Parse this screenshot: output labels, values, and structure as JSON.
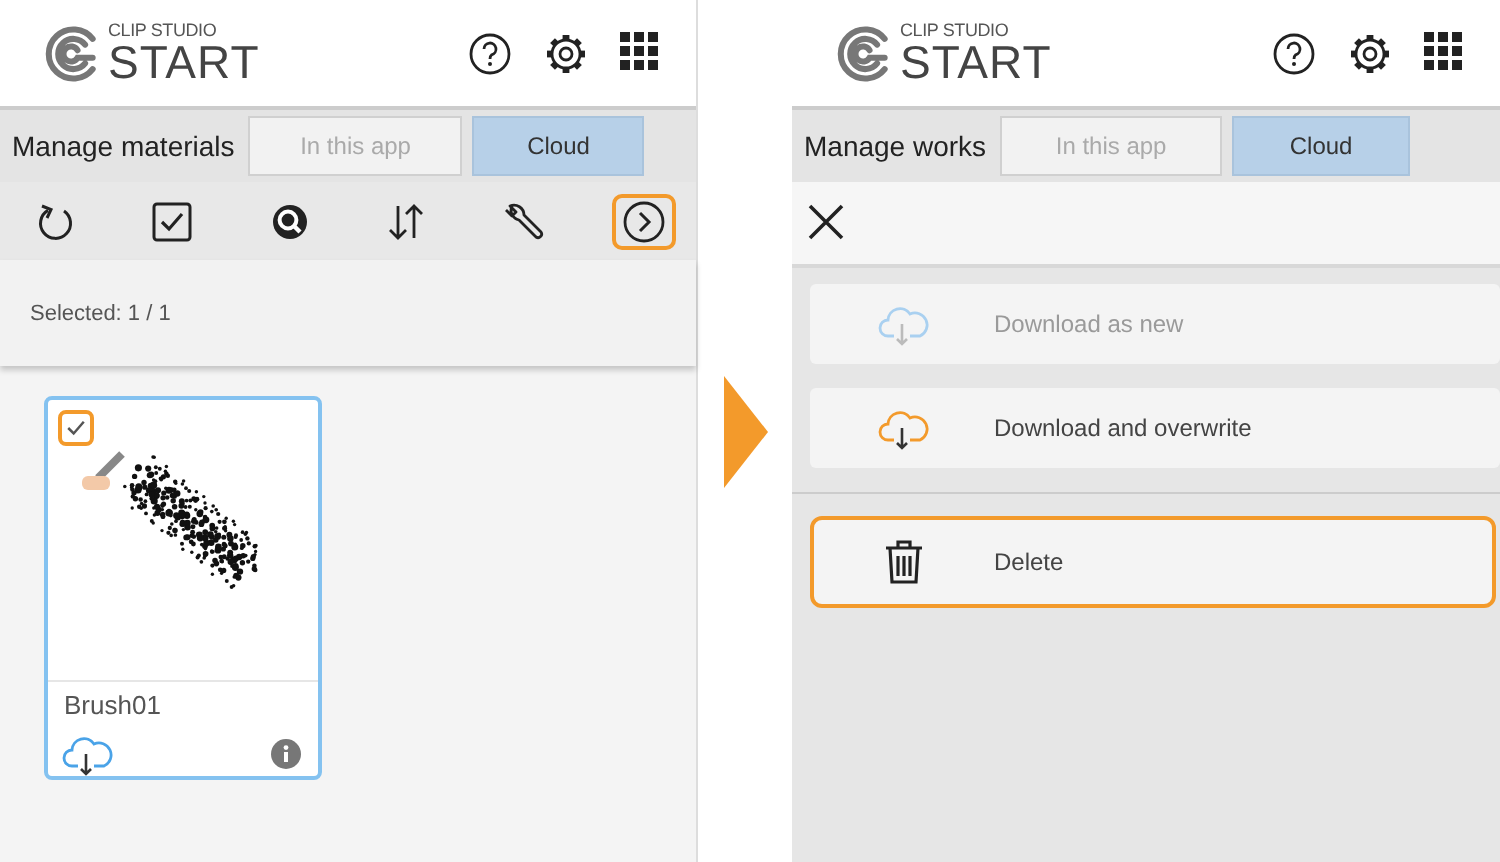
{
  "materials_screen": {
    "logo": {
      "top": "CLIP STUDIO",
      "main": "START"
    },
    "title": "Manage materials",
    "tabs": [
      {
        "label": "In this app",
        "selected": false
      },
      {
        "label": "Cloud",
        "selected": true
      }
    ],
    "toolbar": [
      {
        "kind": "refresh",
        "highlighted": false
      },
      {
        "kind": "select",
        "highlighted": false
      },
      {
        "kind": "search",
        "highlighted": false
      },
      {
        "kind": "sort",
        "highlighted": false
      },
      {
        "kind": "wrench",
        "highlighted": false
      },
      {
        "kind": "next",
        "highlighted": true
      }
    ],
    "selection_text": "Selected: 1 / 1",
    "materials": [
      {
        "name": "Brush01",
        "selected": true,
        "checked": true,
        "highlighted": true
      }
    ]
  },
  "works_screen": {
    "logo": {
      "top": "CLIP STUDIO",
      "main": "START"
    },
    "title": "Manage works",
    "tabs": [
      {
        "label": "In this app",
        "selected": false
      },
      {
        "label": "Cloud",
        "selected": true
      }
    ],
    "menu": [
      {
        "kind": "download",
        "label": "Download as new",
        "disabled": true,
        "separated": false,
        "highlighted": false
      },
      {
        "kind": "download",
        "label": "Download and overwrite",
        "disabled": false,
        "separated": false,
        "highlighted": false
      },
      {
        "kind": "delete",
        "label": "Delete",
        "disabled": false,
        "separated": true,
        "highlighted": true
      }
    ]
  }
}
